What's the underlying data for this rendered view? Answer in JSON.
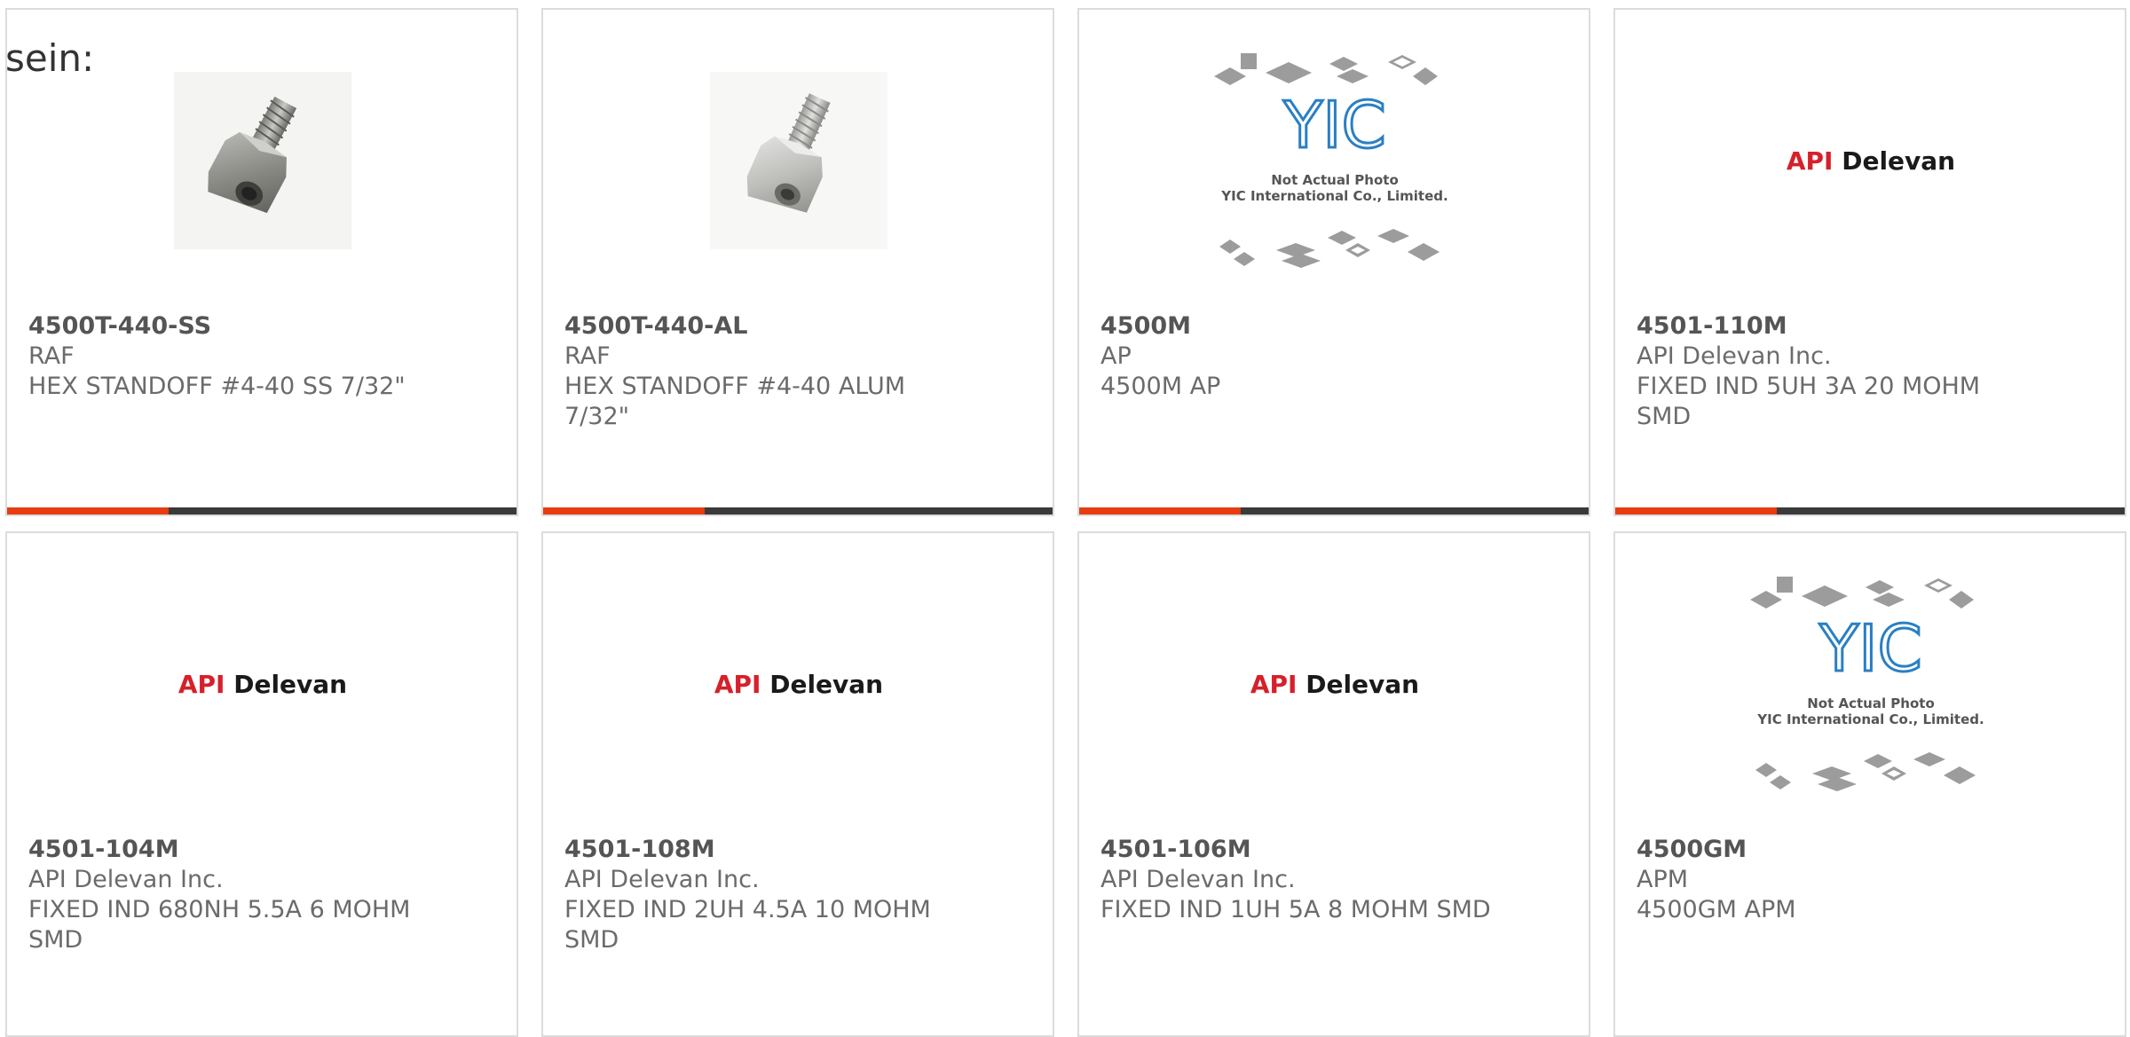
{
  "intro_text": "sein:",
  "colors": {
    "accent": "#e53c12",
    "bar": "#3a3a3a",
    "card_border": "#dcdcdc",
    "logo_red": "#d6202a"
  },
  "logos": {
    "api_delevan": {
      "api": "API",
      "delevan": "Delevan"
    },
    "yic": {
      "mark": "YIC",
      "line1": "Not Actual Photo",
      "line2": "YIC International Co., Limited."
    }
  },
  "products": [
    {
      "part_number": "4500T-440-SS",
      "manufacturer": "RAF",
      "description": "HEX STANDOFF #4-40 SS 7/32\"",
      "image": "hex-standoff-steel-photo"
    },
    {
      "part_number": "4500T-440-AL",
      "manufacturer": "RAF",
      "description": "HEX STANDOFF #4-40 ALUM 7/32\"",
      "image": "hex-standoff-aluminum-photo"
    },
    {
      "part_number": "4500M",
      "manufacturer": "AP",
      "description": "4500M AP",
      "image": "yic-placeholder"
    },
    {
      "part_number": "4501-110M",
      "manufacturer": "API Delevan Inc.",
      "description": "FIXED IND 5UH 3A 20 MOHM SMD",
      "image": "api-delevan-logo"
    },
    {
      "part_number": "4501-104M",
      "manufacturer": "API Delevan Inc.",
      "description": "FIXED IND 680NH 5.5A 6 MOHM SMD",
      "image": "api-delevan-logo"
    },
    {
      "part_number": "4501-108M",
      "manufacturer": "API Delevan Inc.",
      "description": "FIXED IND 2UH 4.5A 10 MOHM SMD",
      "image": "api-delevan-logo"
    },
    {
      "part_number": "4501-106M",
      "manufacturer": "API Delevan Inc.",
      "description": "FIXED IND 1UH 5A 8 MOHM SMD",
      "image": "api-delevan-logo"
    },
    {
      "part_number": "4500GM",
      "manufacturer": "APM",
      "description": "4500GM APM",
      "image": "yic-placeholder"
    }
  ]
}
